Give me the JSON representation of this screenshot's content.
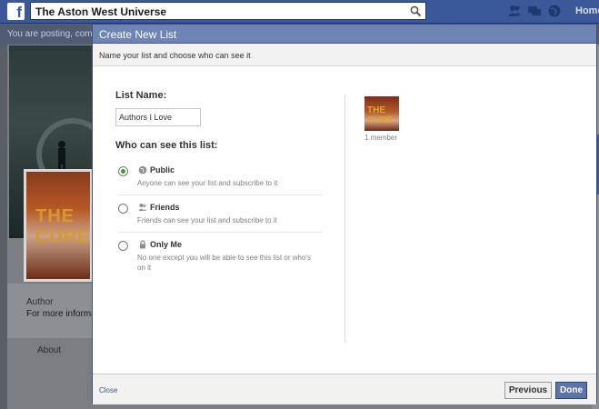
{
  "topbar": {
    "search_value": "The Aston West Universe",
    "home_label": "Home"
  },
  "postbar": {
    "text": "You are posting, comment"
  },
  "background_page": {
    "author_label": "Author",
    "more_info_label": "For more information",
    "about_label": "About"
  },
  "dialog": {
    "title": "Create New List",
    "subtitle": "Name your list and choose who can see it",
    "list_name_label": "List Name:",
    "list_name_value": "Authors I Love",
    "who_label": "Who can see this list:",
    "options": [
      {
        "title": "Public",
        "description": "Anyone can see your list and subscribe to it",
        "checked": true,
        "icon": "globe-icon"
      },
      {
        "title": "Friends",
        "description": "Friends can see your list and subscribe to it",
        "checked": false,
        "icon": "friends-icon"
      },
      {
        "title": "Only Me",
        "description": "No one except you will be able to see this list or who's on it",
        "checked": false,
        "icon": "lock-icon"
      }
    ],
    "member_count": "1 member",
    "thumbnail_text": "THE CURE",
    "close_label": "Close",
    "previous_label": "Previous",
    "done_label": "Done"
  },
  "colors": {
    "facebook_blue": "#3b5998",
    "dialog_header": "#6d84b4",
    "radio_checked": "#3c9a3c"
  }
}
